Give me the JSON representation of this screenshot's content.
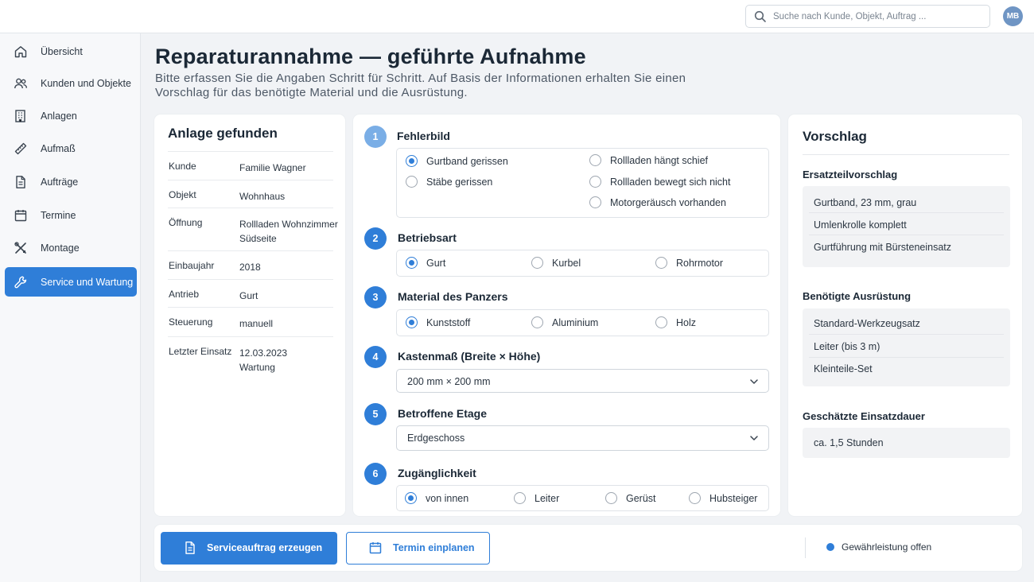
{
  "search": {
    "placeholder": "Suche nach Kunde, Objekt, Auftrag ..."
  },
  "user": {
    "initials": "MB"
  },
  "sidebar": {
    "items": [
      {
        "label": "Übersicht",
        "icon": "home-icon"
      },
      {
        "label": "Kunden und Objekte",
        "icon": "users-icon"
      },
      {
        "label": "Anlagen",
        "icon": "building-icon"
      },
      {
        "label": "Aufmaß",
        "icon": "ruler-icon"
      },
      {
        "label": "Aufträge",
        "icon": "document-icon"
      },
      {
        "label": "Termine",
        "icon": "calendar-icon"
      },
      {
        "label": "Montage",
        "icon": "tools-icon"
      },
      {
        "label": "Service und Wartung",
        "icon": "wrench-icon",
        "active": true
      }
    ]
  },
  "header": {
    "title": "Reparaturannahme — geführte Aufnahme",
    "subtitle": "Bitte erfassen Sie die Angaben Schritt für Schritt. Auf Basis der Informationen erhalten Sie einen Vorschlag für das benötigte Material und die Ausrüstung."
  },
  "anlage": {
    "title": "Anlage gefunden",
    "rows": [
      {
        "key": "Kunde",
        "value": "Familie Wagner"
      },
      {
        "key": "Objekt",
        "value": "Wohnhaus"
      },
      {
        "key": "Öffnung",
        "value": "Rollladen Wohnzimmer Südseite"
      },
      {
        "key": "Einbaujahr",
        "value": "2018"
      },
      {
        "key": "Antrieb",
        "value": "Gurt"
      },
      {
        "key": "Steuerung",
        "value": "manuell"
      },
      {
        "key": "Letzter Einsatz",
        "value": "12.03.2023 Wartung"
      }
    ]
  },
  "steps": {
    "s1": {
      "num": "1",
      "title": "Fehlerbild",
      "options": [
        "Gurtband gerissen",
        "Stäbe gerissen",
        "Rollladen hängt schief",
        "Rollladen bewegt sich nicht",
        "Motorgeräusch vorhanden"
      ],
      "selected": "Gurtband gerissen"
    },
    "s2": {
      "num": "2",
      "title": "Betriebsart",
      "options": [
        "Gurt",
        "Kurbel",
        "Rohrmotor"
      ],
      "selected": "Gurt"
    },
    "s3": {
      "num": "3",
      "title": "Material des Panzers",
      "options": [
        "Kunststoff",
        "Aluminium",
        "Holz"
      ],
      "selected": "Kunststoff"
    },
    "s4": {
      "num": "4",
      "title": "Kastenmaß (Breite × Höhe)",
      "value": "200 mm × 200 mm"
    },
    "s5": {
      "num": "5",
      "title": "Betroffene Etage",
      "value": "Erdgeschoss"
    },
    "s6": {
      "num": "6",
      "title": "Zugänglichkeit",
      "options": [
        "von innen",
        "Leiter",
        "Gerüst",
        "Hubsteiger"
      ],
      "selected": "von innen"
    }
  },
  "vorschlag": {
    "title": "Vorschlag",
    "ersatz": {
      "title": "Ersatzteilvorschlag",
      "items": [
        "Gurtband, 23 mm, grau",
        "Umlenkrolle komplett",
        "Gurtführung mit Bürsteneinsatz"
      ]
    },
    "ausruestung": {
      "title": "Benötigte Ausrüstung",
      "items": [
        "Standard-Werkzeugsatz",
        "Leiter (bis 3 m)",
        "Kleinteile-Set"
      ]
    },
    "dauer": {
      "title": "Geschätzte Einsatzdauer",
      "value": "ca. 1,5 Stunden"
    }
  },
  "footer": {
    "primary_label": "Serviceauftrag erzeugen",
    "secondary_label": "Termin einplanen",
    "status": "Gewährleistung offen"
  },
  "colors": {
    "accent": "#2f7ed8",
    "step_inactive": "#7aaee6"
  }
}
